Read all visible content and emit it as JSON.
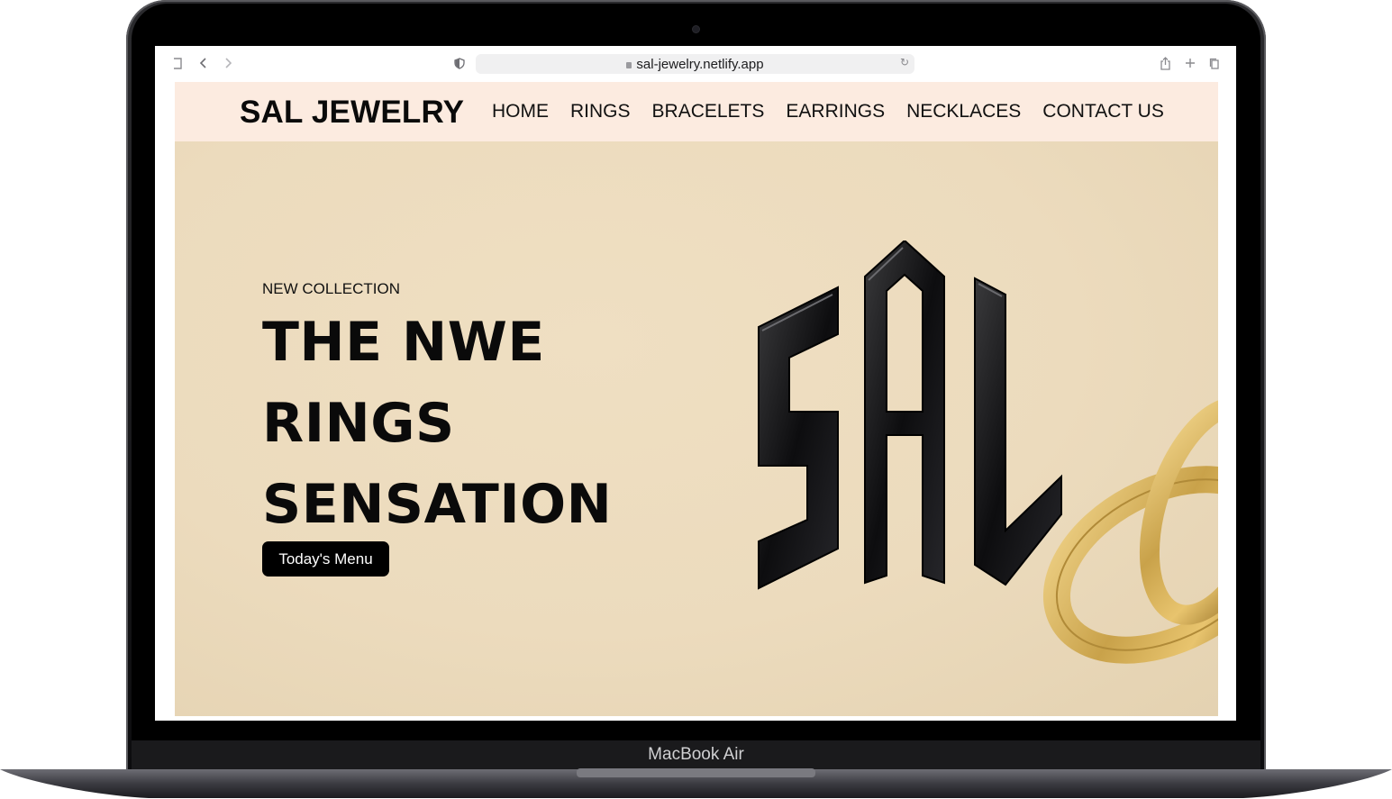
{
  "device": {
    "model_label": "MacBook Air"
  },
  "browser": {
    "url": "sal-jewelry.netlify.app",
    "sidebar_icon": "sidebar-icon",
    "back_icon": "chevron-left-icon",
    "forward_icon": "chevron-right-icon",
    "privacy_icon": "shield-icon",
    "reload_icon": "reload-icon",
    "share_icon": "share-icon",
    "new_tab_icon": "plus-icon",
    "tabs_icon": "tabs-overview-icon"
  },
  "site": {
    "brand": "SAL JEWELRY",
    "nav": [
      {
        "label": "HOME"
      },
      {
        "label": "RINGS"
      },
      {
        "label": "BRACELETS"
      },
      {
        "label": "EARRINGS"
      },
      {
        "label": "NECKLACES"
      },
      {
        "label": "CONTACT US"
      }
    ],
    "hero": {
      "kicker": "NEW COLLECTION",
      "title_lines": [
        "THE NWE",
        "RINGS",
        "SENSATION"
      ],
      "cta_label": "Today's Menu",
      "logo_text": "SAL"
    },
    "colors": {
      "nav_background": "#fcebe0",
      "hero_background": "#ecdbbd",
      "cta_background": "#000000",
      "gold": "#c9a24a"
    }
  }
}
